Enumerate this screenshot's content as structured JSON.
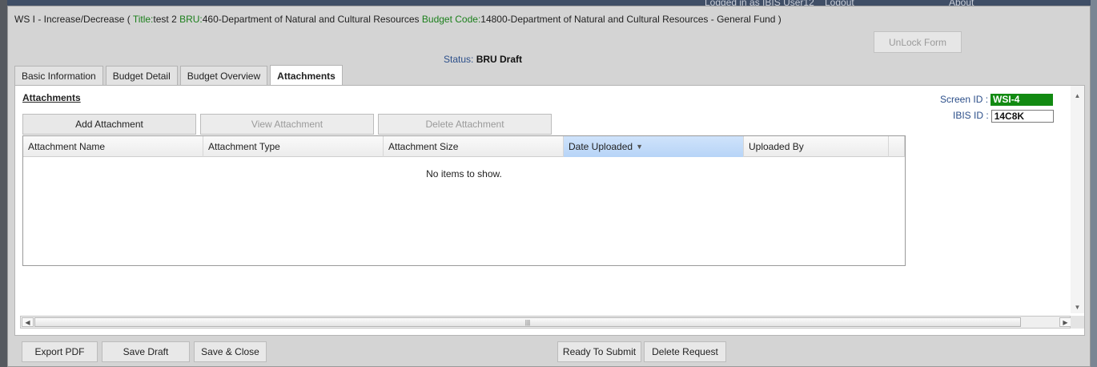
{
  "background": {
    "logged_in": "Logged in as IBIS User12",
    "logout": "Logout",
    "about": "About"
  },
  "dialog": {
    "title_prefix": "WS I - Increase/Decrease ( ",
    "title_label": "Title:",
    "title_value": "test 2 ",
    "bru_label": "BRU:",
    "bru_value": "460-Department of Natural and Cultural Resources ",
    "budget_code_label": "Budget Code:",
    "budget_code_value": "14800-Department of Natural and Cultural Resources - General Fund )",
    "unlock_label": "UnLock Form",
    "status_label": "Status: ",
    "status_value": "BRU Draft",
    "tabs": [
      {
        "label": "Basic Information"
      },
      {
        "label": "Budget Detail"
      },
      {
        "label": "Budget Overview"
      },
      {
        "label": "Attachments"
      }
    ],
    "active_tab": "Attachments"
  },
  "attachments": {
    "section_title": "Attachments",
    "add_label": "Add Attachment",
    "view_label": "View Attachment",
    "delete_label": "Delete Attachment",
    "columns": [
      "Attachment Name",
      "Attachment Type",
      "Attachment Size",
      "Date Uploaded",
      "Uploaded By"
    ],
    "sorted_column": "Date Uploaded",
    "empty_message": "No items to show."
  },
  "ids": {
    "screen_label": "Screen ID :",
    "screen_value": "WSI-4",
    "ibis_label": "IBIS ID :",
    "ibis_value": "14C8K"
  },
  "footer": {
    "export_pdf": "Export PDF",
    "save_draft": "Save Draft",
    "save_close": "Save & Close",
    "ready_submit": "Ready To Submit",
    "delete_request": "Delete Request"
  },
  "icons": {
    "scroll_up": "scroll-up-icon",
    "scroll_down": "scroll-down-icon",
    "scroll_left": "scroll-left-icon",
    "scroll_right": "scroll-right-icon",
    "sort_desc": "sort-descending-icon"
  },
  "colors": {
    "label_green": "#1b7f1b",
    "screen_id_bg": "#128a12",
    "sorted_header": "#b7d4f7"
  }
}
